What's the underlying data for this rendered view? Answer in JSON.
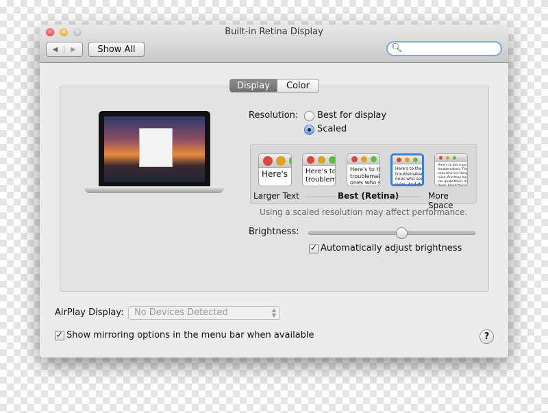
{
  "window": {
    "title": "Built-in Retina Display"
  },
  "toolbar": {
    "back_icon": "chevron-left",
    "forward_icon": "chevron-right",
    "show_all": "Show All",
    "search_placeholder": ""
  },
  "tabs": [
    {
      "label": "Display",
      "selected": true
    },
    {
      "label": "Color",
      "selected": false
    }
  ],
  "resolution": {
    "label": "Resolution:",
    "options": [
      {
        "label": "Best for display",
        "selected": false
      },
      {
        "label": "Scaled",
        "selected": true
      }
    ],
    "scales": [
      {
        "preview": "Here's",
        "selected": false
      },
      {
        "preview": "Here's to\ntroublem",
        "selected": false
      },
      {
        "preview": "Here's to th\ntroublemak\nones who s",
        "selected": false
      },
      {
        "preview": "Here's to the c\ntroublemakers.\nones who see t\nrules. And they",
        "selected": true
      },
      {
        "preview": "Here's to the crazy one\ntroublemakers. The rou\nones who see things dif\nrules. And they have no\ncan quote them, disagr\nthem. About the only th\nbecause they change th",
        "selected": false
      }
    ],
    "scale_labels": {
      "left": "Larger Text",
      "middle": "Best (Retina)",
      "right": "More Space"
    },
    "note": "Using a scaled resolution may affect performance."
  },
  "brightness": {
    "label": "Brightness:",
    "value": 0.57,
    "auto_label": "Automatically adjust brightness",
    "auto_checked": true
  },
  "airplay": {
    "label": "AirPlay Display:",
    "value": "No Devices Detected"
  },
  "mirroring": {
    "label": "Show mirroring options in the menu bar when available",
    "checked": true
  },
  "help": {
    "label": "?"
  },
  "colors": {
    "close": "#e0443e",
    "minimize": "#dea123",
    "selection": "#3b7ddd"
  }
}
